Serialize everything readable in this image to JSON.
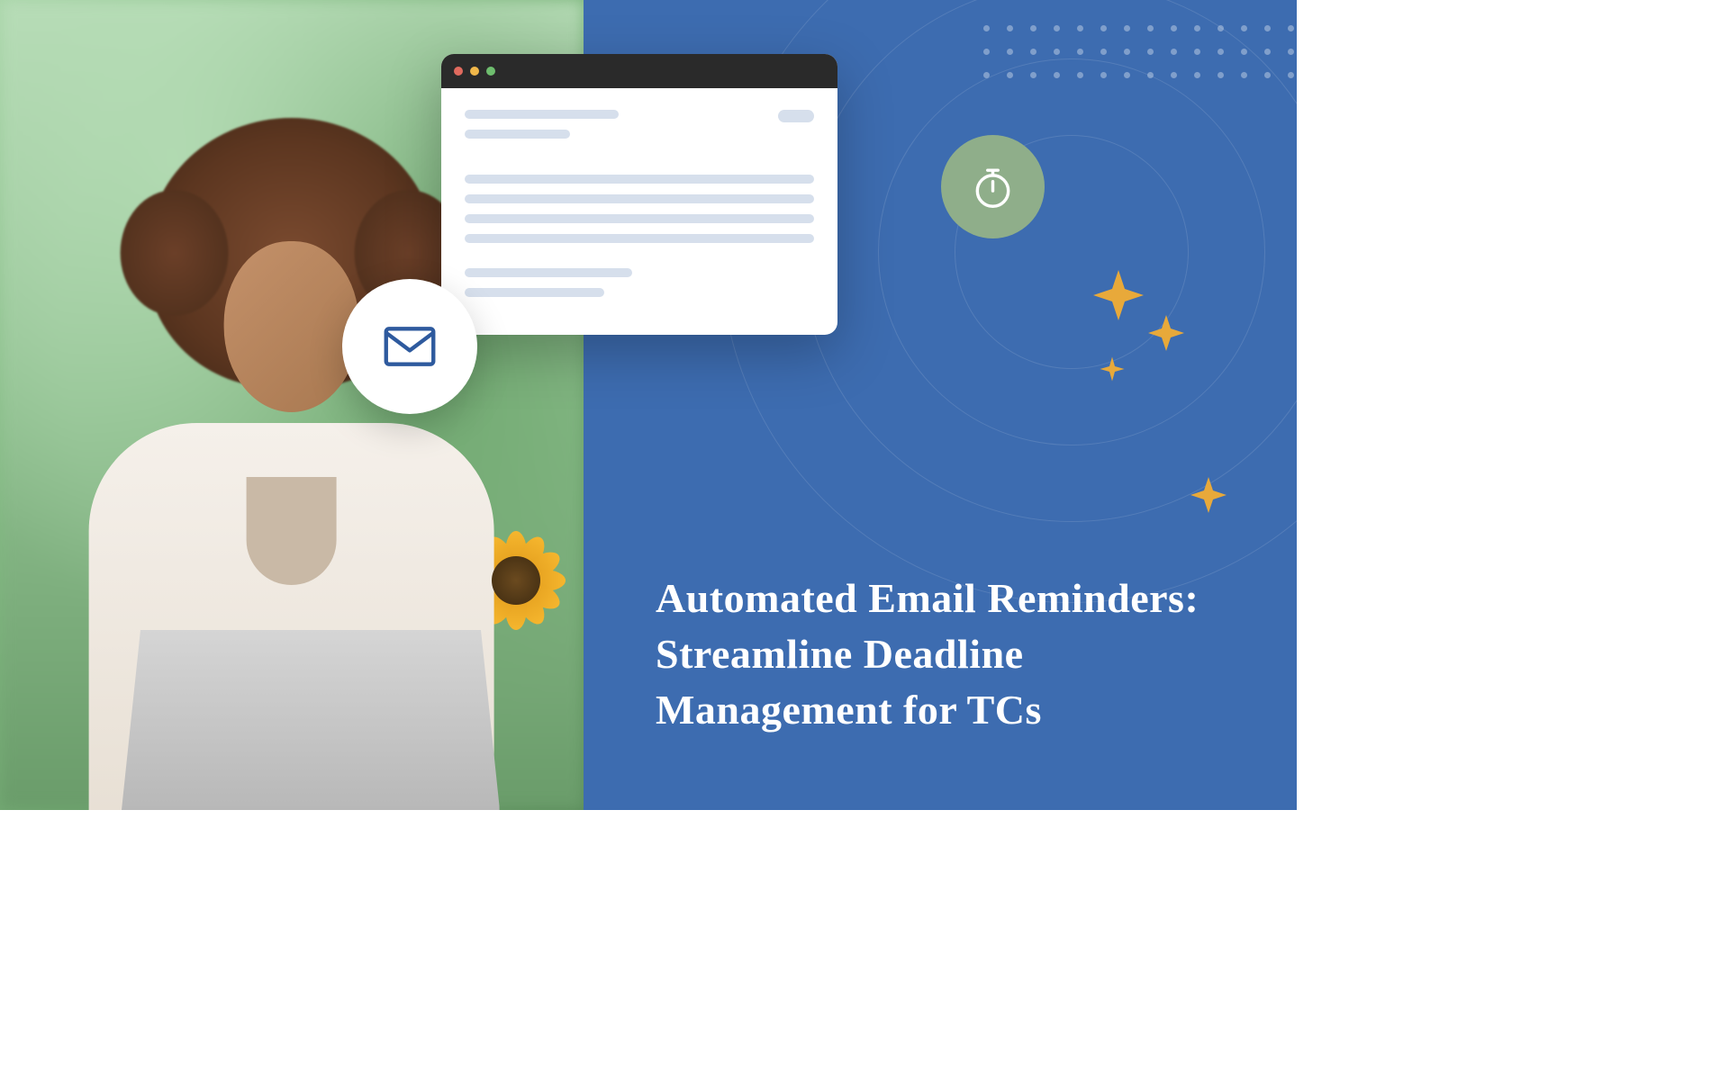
{
  "headline": "Automated Email Reminders: Streamline Deadline Management for TCs",
  "colors": {
    "panel_bg": "#3d6cb0",
    "accent_yellow": "#e8a93a",
    "badge_green": "#8fae8a",
    "mail_icon": "#2e5a9e",
    "timer_icon": "#ffffff"
  },
  "icons": {
    "mail": "mail-icon",
    "timer": "stopwatch-icon",
    "sparkle": "sparkle-icon",
    "window_dots": [
      "red",
      "yellow",
      "green"
    ]
  }
}
